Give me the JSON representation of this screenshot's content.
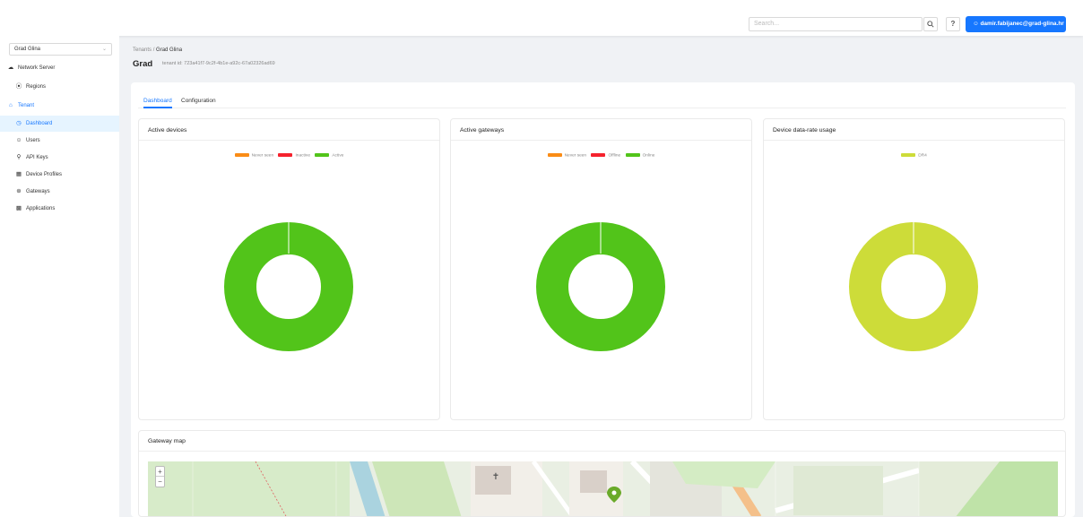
{
  "header": {
    "search_placeholder": "Search...",
    "search_icon": "search-icon",
    "help_label": "?",
    "user_label": "damir.fabijanec@grad-glina.hr",
    "user_icon": "user-icon",
    "accent": "#1677ff"
  },
  "sidebar": {
    "tenant_select": "Grad Glina",
    "items": [
      {
        "label": "Network Server",
        "icon": "cloud-icon"
      },
      {
        "label": "Regions",
        "icon": "compass-icon"
      },
      {
        "label": "Tenant",
        "icon": "home-icon"
      },
      {
        "label": "Dashboard",
        "icon": "dashboard-icon"
      },
      {
        "label": "Users",
        "icon": "user-icon"
      },
      {
        "label": "API Keys",
        "icon": "key-icon"
      },
      {
        "label": "Device Profiles",
        "icon": "grid-icon"
      },
      {
        "label": "Gateways",
        "icon": "wifi-icon"
      },
      {
        "label": "Applications",
        "icon": "apps-icon"
      }
    ]
  },
  "breadcrumb": {
    "root": "Tenants",
    "separator": "/",
    "current": "Grad Glina"
  },
  "page": {
    "title": "Grad",
    "tenant_id": "tenant id: 723a41f7-9c2f-4b1e-a92c-67a02326ad69"
  },
  "tabs": [
    "Dashboard",
    "Configuration"
  ],
  "panels": {
    "active_devices": {
      "title": "Active devices",
      "legend": [
        {
          "label": "Never seen",
          "color": "#fa8c16"
        },
        {
          "label": "Inactive",
          "color": "#f5222d"
        },
        {
          "label": "Active",
          "color": "#52c41a"
        }
      ],
      "ring_color": "#52c41a"
    },
    "active_gateways": {
      "title": "Active gateways",
      "legend": [
        {
          "label": "Never seen",
          "color": "#fa8c16"
        },
        {
          "label": "Offline",
          "color": "#f5222d"
        },
        {
          "label": "Online",
          "color": "#52c41a"
        }
      ],
      "ring_color": "#52c41a"
    },
    "data_rate": {
      "title": "Device data-rate usage",
      "legend": [
        {
          "label": "DR4",
          "color": "#cddc39"
        }
      ],
      "ring_color": "#cddc39"
    }
  },
  "map": {
    "title": "Gateway map",
    "zoom_in": "+",
    "zoom_out": "−"
  }
}
